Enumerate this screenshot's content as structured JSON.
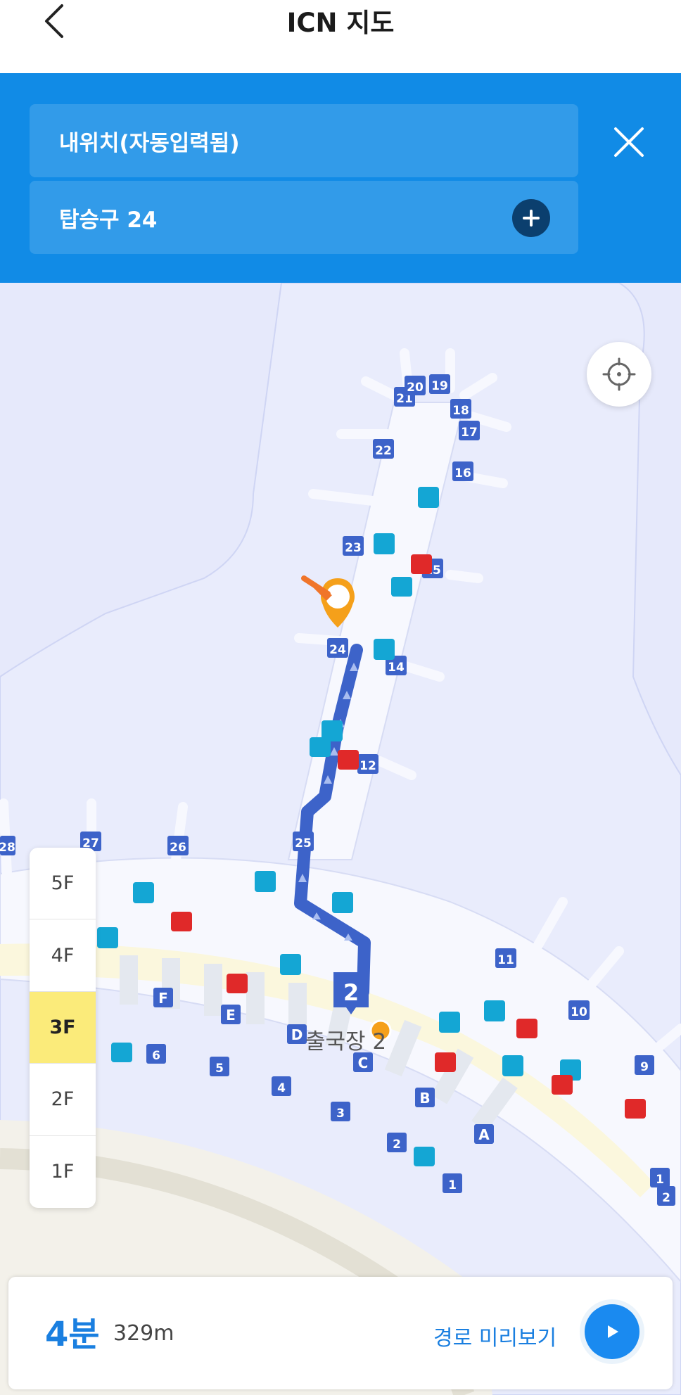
{
  "header": {
    "title": "ICN 지도",
    "back_icon": "chevron-left-icon"
  },
  "route": {
    "from_value": "내위치(자동입력됨)",
    "to_value": "탑승구 24",
    "add_icon": "plus-icon",
    "close_icon": "close-icon"
  },
  "map": {
    "area_label": "출국장 2",
    "area_number": "2",
    "gates": [
      "12",
      "14",
      "15",
      "16",
      "17",
      "18",
      "19",
      "20",
      "21",
      "22",
      "23",
      "24",
      "25",
      "26",
      "27",
      "28",
      "1",
      "2",
      "3",
      "4",
      "5",
      "6",
      "9",
      "10",
      "11"
    ],
    "counters": [
      "A",
      "B",
      "C",
      "D",
      "E",
      "F"
    ],
    "locate_icon": "crosshair-icon",
    "marker_icon": "destination-pin-icon"
  },
  "floors": {
    "items": [
      "5F",
      "4F",
      "3F",
      "2F",
      "1F"
    ],
    "selected": "3F"
  },
  "summary": {
    "time": "4분",
    "distance": "329m",
    "preview_label": "경로 미리보기",
    "play_icon": "play-icon"
  },
  "colors": {
    "primary": "#118be6",
    "accent": "#1a7fe0",
    "route": "#3d63c9",
    "marker": "#f5a01a",
    "floor_active": "#fbeb7a",
    "map_bg": "#e6e9fb",
    "terminal": "#f7f8fe"
  }
}
